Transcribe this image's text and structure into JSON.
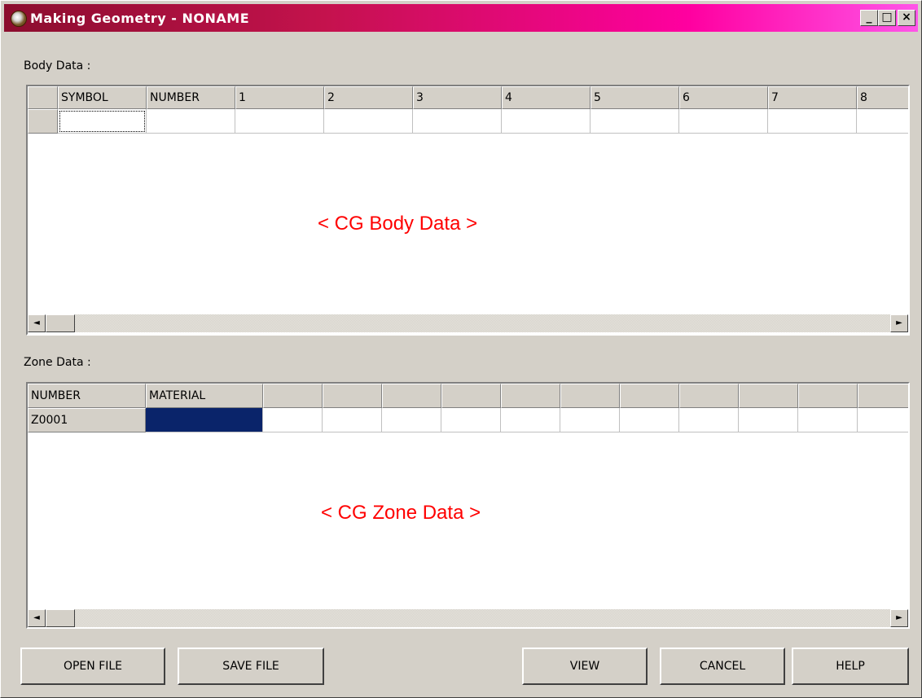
{
  "window": {
    "title": "Making Geometry - NONAME"
  },
  "controls": {
    "minimize": "_",
    "maximize": "□",
    "close": "×"
  },
  "body_section": {
    "label": "Body Data :",
    "columns": [
      "",
      "SYMBOL",
      "NUMBER",
      "1",
      "2",
      "3",
      "4",
      "5",
      "6",
      "7",
      "8"
    ],
    "placeholder": "< CG Body Data >"
  },
  "zone_section": {
    "label": "Zone Data :",
    "columns": [
      "NUMBER",
      "MATERIAL",
      "",
      "",
      "",
      "",
      "",
      "",
      "",
      "",
      "",
      ""
    ],
    "row_label": "Z0001",
    "placeholder": "< CG Zone Data >"
  },
  "scroll": {
    "left": "◄",
    "right": "►"
  },
  "buttons": {
    "open": "OPEN FILE",
    "save": "SAVE FILE",
    "view": "VIEW",
    "cancel": "CANCEL",
    "help": "HELP"
  },
  "colors": {
    "title_start": "#8b0d2e",
    "title_end": "#ff55e8",
    "selection": "#0a246a",
    "placeholder_text": "#ff0000"
  }
}
